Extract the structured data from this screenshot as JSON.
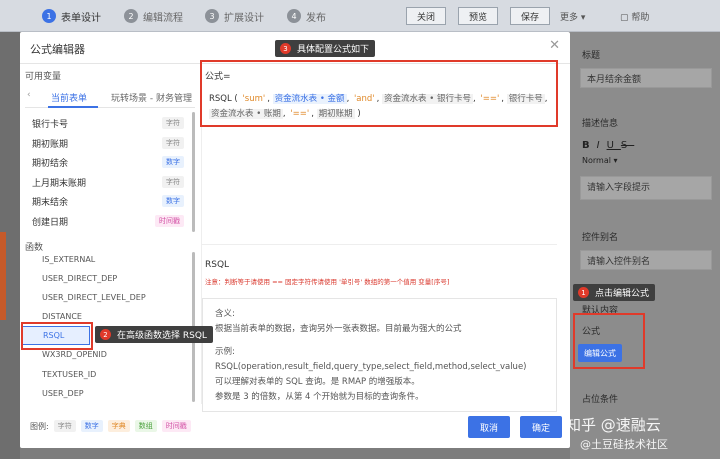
{
  "topbar": {
    "steps": [
      {
        "num": "1",
        "label": "表单设计"
      },
      {
        "num": "2",
        "label": "编辑流程"
      },
      {
        "num": "3",
        "label": "扩展设计"
      },
      {
        "num": "4",
        "label": "发布"
      }
    ],
    "close": "关闭",
    "preview": "预览",
    "save": "保存",
    "more": "更多",
    "help": "帮助"
  },
  "right_panel": {
    "title_label": "标题",
    "title_value": "本月结余金额",
    "desc_label": "描述信息",
    "normal": "Normal",
    "desc_placeholder": "请输入字段提示",
    "alias_label": "控件别名",
    "alias_placeholder": "请输入控件别名",
    "default_label": "默认内容",
    "formula_label": "公式",
    "edit_formula": "编辑公式",
    "bottom_label": "占位条件"
  },
  "modal": {
    "title": "公式编辑器",
    "variables_heading": "可用变量",
    "tabs": [
      "当前表单",
      "玩转场景 - 财务管理"
    ],
    "variables": [
      {
        "name": "银行卡号",
        "type": "字符"
      },
      {
        "name": "期初账期",
        "type": "字符"
      },
      {
        "name": "期初结余",
        "type": "数字"
      },
      {
        "name": "上月期末账期",
        "type": "字符"
      },
      {
        "name": "期末结余",
        "type": "数字"
      },
      {
        "name": "创建日期",
        "type": "时间戳"
      }
    ],
    "functions_heading": "函数",
    "functions": [
      "IS_EXTERNAL",
      "USER_DIRECT_DEP",
      "USER_DIRECT_LEVEL_DEP",
      "DISTANCE",
      "RSQL",
      "WX3RD_OPENID",
      "TEXTUSER_ID",
      "USER_DEP"
    ],
    "legend_label": "图例:",
    "legend": [
      "字符",
      "数字",
      "字典",
      "数组",
      "时间戳"
    ],
    "formula_label": "公式=",
    "formula": {
      "fn": "RSQL (",
      "p1": "'sum'",
      "field": "资金流水表 • 金额",
      "p2": "'and'",
      "var1": "资金流水表 • 银行卡号",
      "p3": "'=='",
      "var2": "银行卡号",
      "var3": "资金流水表 • 账期",
      "p4": "'=='",
      "var4": "期初账期",
      "close": ")"
    },
    "fn_title": "RSQL",
    "fn_note": "注意：判断等于请使用 == 固定字符传请使用 '单引号' 数组的第一个值用 变量[序号]",
    "desc_lines": [
      "含义:",
      "根据当前表单的数据，查询另外一张表数据。目前最为强大的公式",
      "",
      "示例:",
      "RSQL(operation,result_field,query_type,select_field,method,select_value)",
      "可以理解对表单的 SQL 查询。是 RMAP 的增强版本。",
      "参数是 3 的倍数，从第 4 个开始就为目标的查询条件。"
    ],
    "cancel": "取消",
    "confirm": "确定"
  },
  "annotations": {
    "a1": {
      "num": "1",
      "text": "点击编辑公式"
    },
    "a2": {
      "num": "2",
      "text": "在高级函数选择 RSQL"
    },
    "a3": {
      "num": "3",
      "text": "具体配置公式如下"
    }
  },
  "watermark": {
    "line1": "知乎 @速融云",
    "line2": "@土豆硅技术社区"
  }
}
